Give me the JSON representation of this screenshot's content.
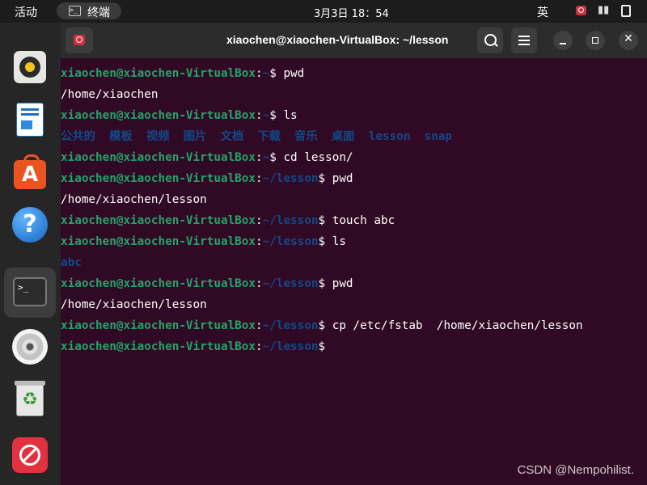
{
  "topbar": {
    "activities": "活动",
    "app_label": "终端",
    "app_icon_text": ">_",
    "clock": "3月3日  18：54",
    "ime": "英",
    "volume_icon": "▮▮"
  },
  "dock": {
    "items": [
      "rhythmbox",
      "libreoffice-writer",
      "ubuntu-software",
      "help",
      "terminal",
      "dvd",
      "trash",
      "blocked-app"
    ],
    "terminal_glyph": ">_",
    "help_glyph": "?",
    "software_glyph": "A",
    "trash_glyph": "♻"
  },
  "window": {
    "title": "xiaochen@xiaochen-VirtualBox: ~/lesson",
    "close_glyph": "✕"
  },
  "terminal": {
    "user_host": "xiaochen@xiaochen-VirtualBox",
    "lines": [
      {
        "type": "prompt",
        "path": "~",
        "cmd": "pwd"
      },
      {
        "type": "out",
        "text": "/home/xiaochen"
      },
      {
        "type": "prompt",
        "path": "~",
        "cmd": "ls"
      },
      {
        "type": "dirs",
        "items": [
          "公共的",
          "模板",
          "视频",
          "图片",
          "文档",
          "下载",
          "音乐",
          "桌面",
          "lesson",
          "snap"
        ]
      },
      {
        "type": "prompt",
        "path": "~",
        "cmd": "cd lesson/"
      },
      {
        "type": "prompt",
        "path": "~/lesson",
        "cmd": "pwd"
      },
      {
        "type": "out",
        "text": "/home/xiaochen/lesson"
      },
      {
        "type": "prompt",
        "path": "~/lesson",
        "cmd": "touch abc"
      },
      {
        "type": "prompt",
        "path": "~/lesson",
        "cmd": "ls"
      },
      {
        "type": "file",
        "text": "abc"
      },
      {
        "type": "prompt",
        "path": "~/lesson",
        "cmd": "pwd"
      },
      {
        "type": "out",
        "text": "/home/xiaochen/lesson"
      },
      {
        "type": "prompt",
        "path": "~/lesson",
        "cmd": "cp /etc/fstab  /home/xiaochen/lesson"
      },
      {
        "type": "prompt",
        "path": "~/lesson",
        "cmd": ""
      }
    ]
  },
  "watermark": "CSDN @Nempohilist.",
  "colors": {
    "background": "#300a24",
    "prompt_user": "#26a269",
    "directory": "#12488b",
    "accent": "#e95420"
  }
}
